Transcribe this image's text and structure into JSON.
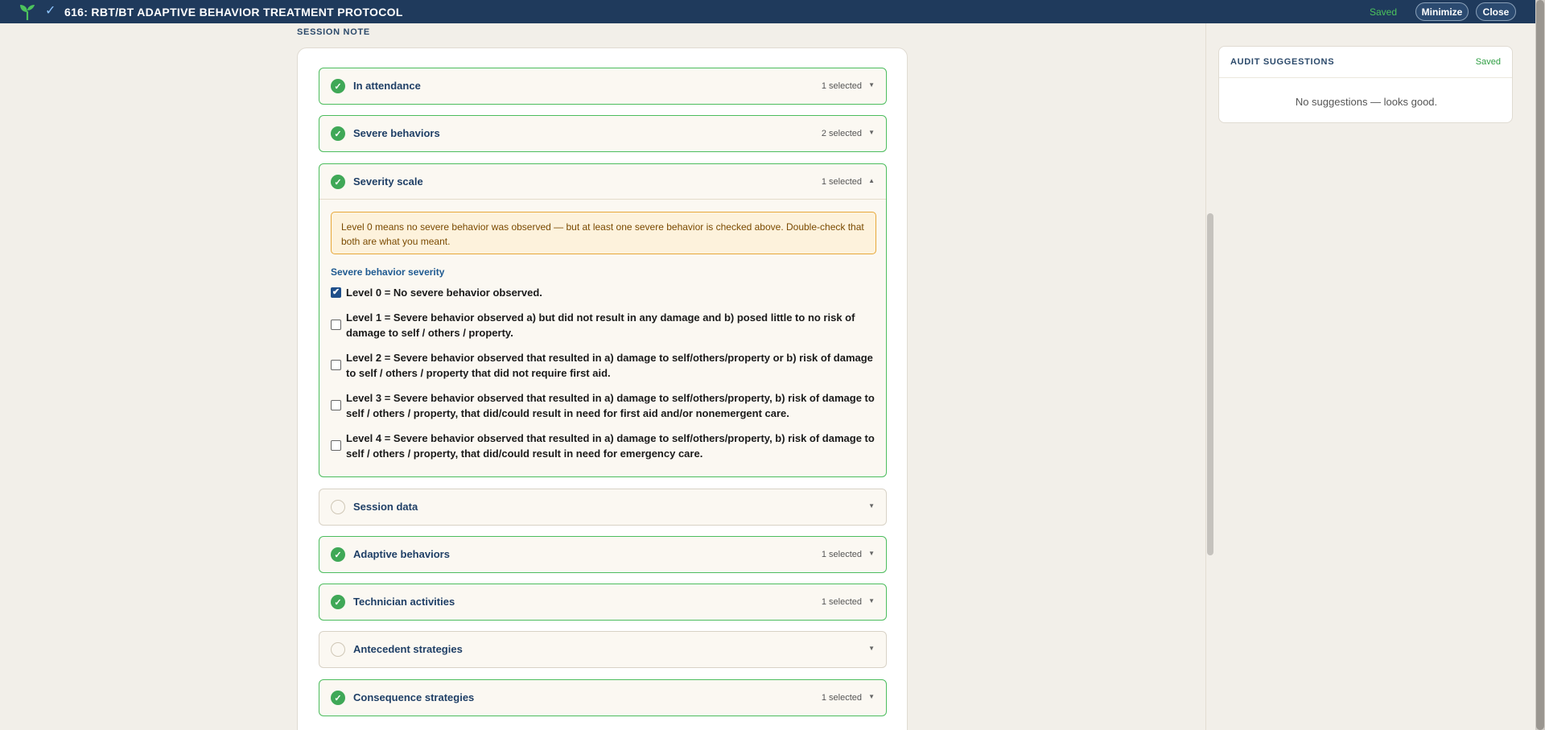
{
  "topbar": {
    "title": "616: RBT/BT ADAPTIVE BEHAVIOR TREATMENT PROTOCOL",
    "saved": "Saved",
    "minimize": "Minimize",
    "close": "Close"
  },
  "section_label": "SESSION NOTE",
  "accordions": [
    {
      "title": "In attendance",
      "count": "1 selected",
      "status": "complete",
      "caret": "▼"
    },
    {
      "title": "Severe behaviors",
      "count": "2 selected",
      "status": "complete",
      "caret": "▼"
    },
    {
      "title": "Severity scale",
      "count": "1 selected",
      "status": "complete",
      "caret": "▲"
    },
    {
      "title": "Session data",
      "count": "",
      "status": "empty",
      "caret": "▼"
    },
    {
      "title": "Adaptive behaviors",
      "count": "1 selected",
      "status": "complete",
      "caret": "▼"
    },
    {
      "title": "Technician activities",
      "count": "1 selected",
      "status": "complete",
      "caret": "▼"
    },
    {
      "title": "Antecedent strategies",
      "count": "",
      "status": "empty",
      "caret": "▼"
    },
    {
      "title": "Consequence strategies",
      "count": "1 selected",
      "status": "complete",
      "caret": "▼"
    }
  ],
  "severity": {
    "warning": "Level 0 means no severe behavior was observed — but at least one severe behavior is checked above. Double-check that both are what you meant.",
    "label": "Severe behavior severity",
    "options": [
      {
        "text": "Level 0 = No severe behavior observed.",
        "checked": true
      },
      {
        "text": "Level 1 = Severe behavior observed a) but did not result in any damage and b) posed little to no risk of damage to self / others / property.",
        "checked": false
      },
      {
        "text": "Level 2 = Severe behavior observed that resulted in a) damage to self/others/property or b) risk of damage to self / others / property that did not require first aid.",
        "checked": false
      },
      {
        "text": "Level 3 = Severe behavior observed that resulted in a) damage to self/others/property, b) risk of damage to self / others / property, that did/could result in need for first aid and/or nonemergent care.",
        "checked": false
      },
      {
        "text": "Level 4 = Severe behavior observed that resulted in a) damage to self/others/property, b) risk of damage to self / others / property, that did/could result in need for emergency care.",
        "checked": false
      }
    ]
  },
  "audit": {
    "title": "AUDIT SUGGESTIONS",
    "saved": "Saved",
    "message": "No suggestions — looks good."
  },
  "icons": {
    "check": "✓",
    "checkbox_checked": "✔"
  }
}
